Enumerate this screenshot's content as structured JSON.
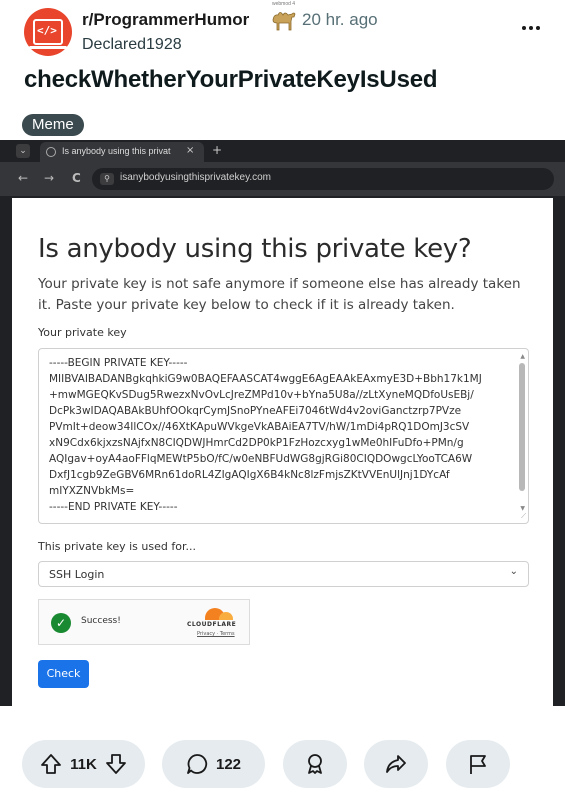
{
  "post": {
    "subreddit": "r/ProgrammerHumor",
    "time_ago": "20 hr. ago",
    "author": "Declared1928",
    "title": "checkWhetherYourPrivateKeyIsUsed",
    "flair": "Meme",
    "award_tag": "webmod 4",
    "avatar_icon": "code-laptop-icon",
    "accent_color": "#e8452c"
  },
  "browser": {
    "tab_title": "Is anybody using this privat",
    "tab_close": "×",
    "new_tab": "+",
    "url": "isanybodyusingthisprivatekey.com",
    "tab_menu_glyph": "⌄",
    "back_glyph": "←",
    "forward_glyph": "→",
    "reload_glyph": "C",
    "site_info_glyph": "⚲"
  },
  "page": {
    "heading": "Is anybody using this private key?",
    "description": "Your private key is not safe anymore if someone else has already taken it. Paste your private key below to check if it is already taken.",
    "key_label": "Your private key",
    "key_text": "-----BEGIN PRIVATE KEY-----\nMIIBVAIBADANBgkqhkiG9w0BAQEFAASCAT4wggE6AgEAAkEAxmyE3D+Bbh17k1MJ\n+mwMGEQKvSDug5RwezxNvOvLcJreZMPd10v+bYna5U8a//zLtXyneMQDfoUsEBj/\nDcPk3wIDAQABAkBUhfOOkqrCymJSnoPYneAFEi7046tWd4v2oviGanctzrp7PVze\nPVmIt+deow34IlCOx//46XtKApuWVkgeVkABAiEA7TV/hW/1mDi4pRQ1DOmJ3cSV\nxN9Cdx6kjxzsNAjfxN8CIQDWJHmrCd2DP0kP1FzHozcxyg1wMe0hIFuDfo+PMn/g\nAQIgav+oyA4aoFFlqMEWtP5bO/fC/w0eNBFUdWG8gjRGi80CIQDOwgcLYooTCA6W\nDxfJ1cgb9ZeGBV6MRn61doRL4ZIgAQIgX6B4kNc8lzFmjsZKtVVEnUlJnj1DYcAf\nmIYXZNVbkMs=\n-----END PRIVATE KEY-----",
    "use_label": "This private key is used for...",
    "use_value": "SSH Login",
    "captcha_status": "Success!",
    "captcha_brand": "CLOUDFLARE",
    "captcha_links": "Privacy · Terms",
    "check_button": "Check",
    "check_glyph": "✓",
    "dropdown_glyph": "⌄",
    "scroll_up_glyph": "▲",
    "scroll_down_glyph": "▼",
    "resize_glyph": "⟋",
    "button_color": "#1a73e8",
    "success_color": "#1a8a32"
  },
  "actions": {
    "votes": "11K",
    "comments": "122",
    "icons": [
      "upvote-icon",
      "downvote-icon",
      "comment-icon",
      "award-icon",
      "share-icon",
      "report-flag-icon"
    ]
  }
}
